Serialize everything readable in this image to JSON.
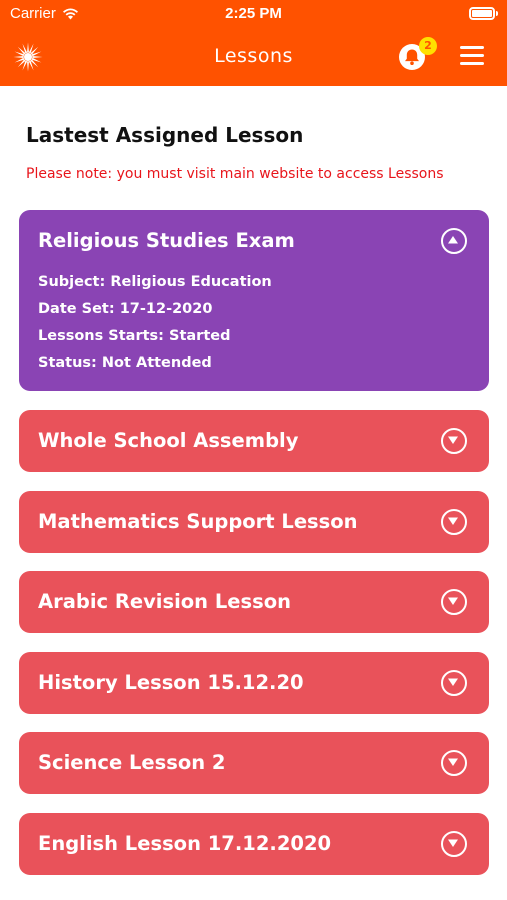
{
  "status_bar": {
    "carrier": "Carrier",
    "time": "2:25 PM"
  },
  "nav": {
    "title": "Lessons",
    "notification_count": "2",
    "icons": [
      "logo-icon",
      "bell-icon",
      "menu-icon"
    ]
  },
  "page": {
    "heading": "Lastest Assigned Lesson",
    "notice": "Please note: you must visit main website to access Lessons"
  },
  "colors": {
    "brand": "#ff5200",
    "active_card": "#8a44b4",
    "card": "#e9525a",
    "notice": "#e8151b",
    "badge": "#ffe000"
  },
  "lessons": [
    {
      "title": "Religious Studies Exam",
      "expanded": true,
      "subject": "Subject: Religious Education",
      "date_set": "Date Set: 17-12-2020",
      "starts": "Lessons Starts: Started",
      "status": "Status: Not Attended"
    },
    {
      "title": "Whole School Assembly",
      "expanded": false
    },
    {
      "title": "Mathematics Support Lesson",
      "expanded": false
    },
    {
      "title": "Arabic Revision Lesson",
      "expanded": false
    },
    {
      "title": "History Lesson 15.12.20",
      "expanded": false
    },
    {
      "title": "Science Lesson 2",
      "expanded": false
    },
    {
      "title": "English Lesson 17.12.2020",
      "expanded": false
    }
  ]
}
